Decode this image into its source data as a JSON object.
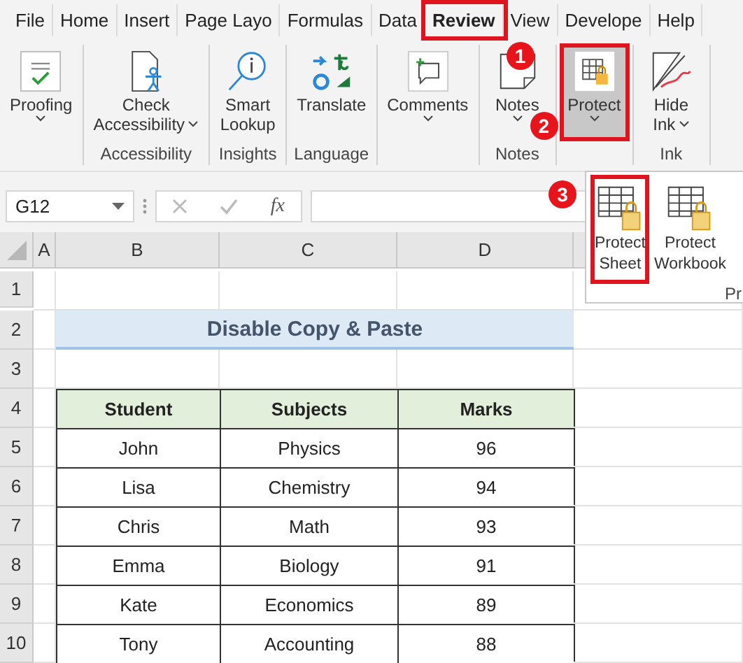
{
  "tabs": [
    {
      "label": "File",
      "highlighted": false
    },
    {
      "label": "Home",
      "highlighted": false
    },
    {
      "label": "Insert",
      "highlighted": false
    },
    {
      "label": "Page Layo",
      "highlighted": false
    },
    {
      "label": "Formulas",
      "highlighted": false
    },
    {
      "label": "Data",
      "highlighted": false
    },
    {
      "label": "Review",
      "highlighted": true,
      "callout": "1"
    },
    {
      "label": "View",
      "highlighted": false
    },
    {
      "label": "Develope",
      "highlighted": false
    },
    {
      "label": "Help",
      "highlighted": false
    }
  ],
  "ribbon_groups": [
    {
      "buttons": [
        {
          "kind": "proofing",
          "lines": [
            "Proofing"
          ],
          "caret": true,
          "pressed": false,
          "highlighted": false
        }
      ]
    },
    {
      "label": "Accessibility",
      "buttons": [
        {
          "kind": "accessibility",
          "lines": [
            "Check",
            "Accessibility"
          ],
          "caret": true,
          "pressed": false,
          "highlighted": false
        }
      ]
    },
    {
      "label": "Insights",
      "buttons": [
        {
          "kind": "lookup",
          "lines": [
            "Smart",
            "Lookup"
          ],
          "caret": false,
          "pressed": false,
          "highlighted": false
        }
      ]
    },
    {
      "label": "Language",
      "buttons": [
        {
          "kind": "translate",
          "lines": [
            "Translate"
          ],
          "caret": false,
          "pressed": false,
          "highlighted": false
        }
      ]
    },
    {
      "buttons": [
        {
          "kind": "comments",
          "lines": [
            "Comments"
          ],
          "caret": true,
          "pressed": false,
          "highlighted": false
        }
      ]
    },
    {
      "label": "Notes",
      "buttons": [
        {
          "kind": "notes",
          "lines": [
            "Notes"
          ],
          "caret": true,
          "pressed": false,
          "highlighted": false
        }
      ]
    },
    {
      "buttons": [
        {
          "kind": "protect",
          "lines": [
            "Protect"
          ],
          "caret": true,
          "pressed": true,
          "highlighted": true,
          "callout": "2"
        }
      ]
    },
    {
      "label": "Ink",
      "buttons": [
        {
          "kind": "ink",
          "lines": [
            "Hide",
            "Ink"
          ],
          "caret": true,
          "pressed": false,
          "highlighted": false
        }
      ]
    }
  ],
  "formula_bar": {
    "name_box": "G12",
    "function_label": "fx"
  },
  "protect_menu": {
    "items": [
      {
        "lines": [
          "Protect",
          "Sheet"
        ],
        "highlighted": true,
        "callout": "3"
      },
      {
        "lines": [
          "Protect",
          "Workbook"
        ],
        "highlighted": false
      }
    ],
    "group_label": "Pr"
  },
  "sheet": {
    "column_letters": [
      "A",
      "B",
      "C",
      "D"
    ],
    "row_numbers": [
      "1",
      "2",
      "3",
      "4",
      "5",
      "6",
      "7",
      "8",
      "9",
      "10"
    ],
    "title": "Disable Copy & Paste",
    "table": {
      "headers": [
        "Student",
        "Subjects",
        "Marks"
      ],
      "rows": [
        [
          "John",
          "Physics",
          "96"
        ],
        [
          "Lisa",
          "Chemistry",
          "94"
        ],
        [
          "Chris",
          "Math",
          "93"
        ],
        [
          "Emma",
          "Biology",
          "91"
        ],
        [
          "Kate",
          "Economics",
          "89"
        ],
        [
          "Tony",
          "Accounting",
          "88"
        ]
      ]
    }
  }
}
